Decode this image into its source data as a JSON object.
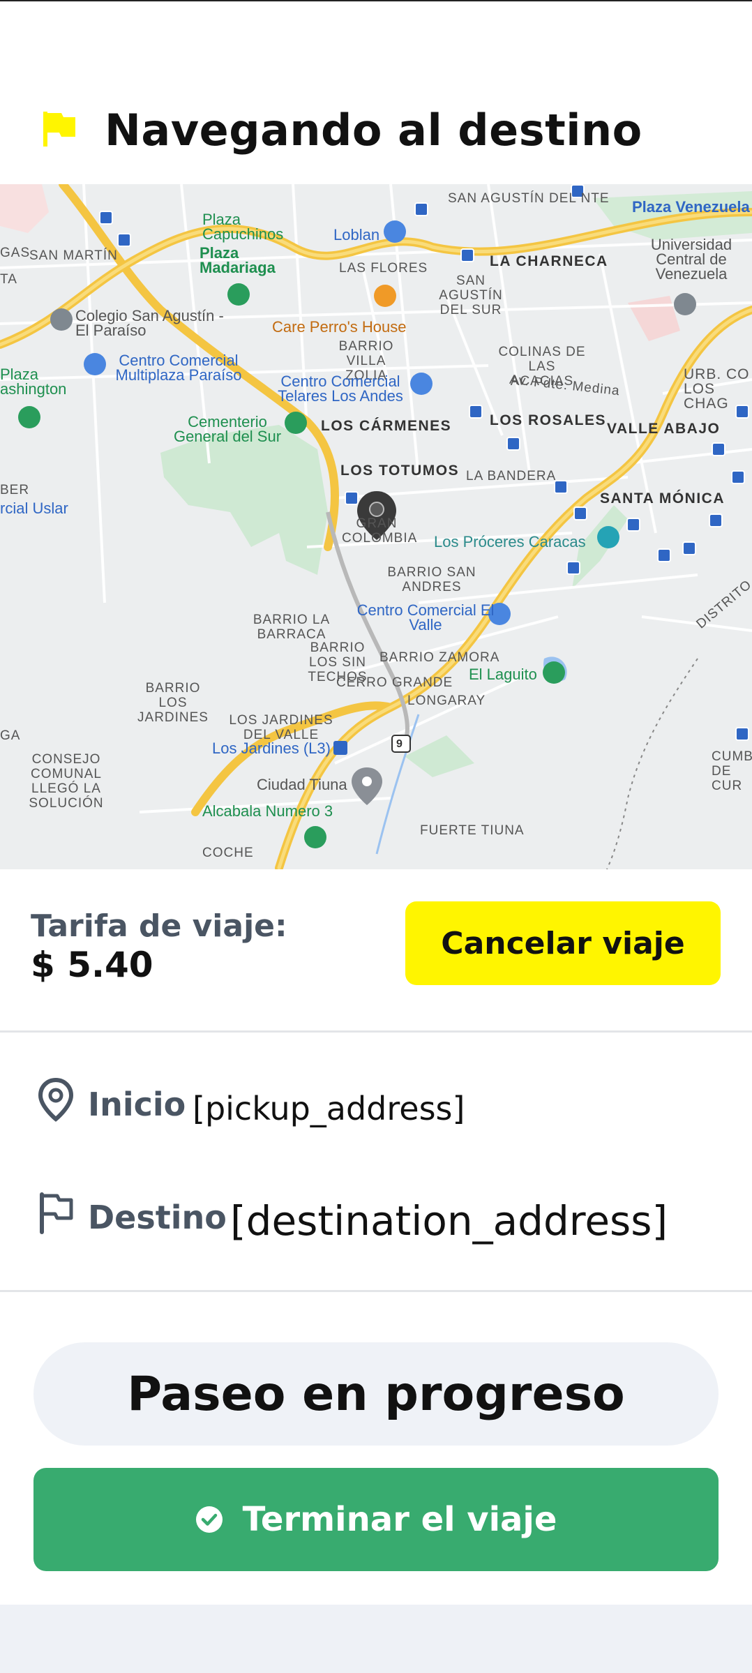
{
  "header": {
    "title": "Navegando al destino",
    "icon": "flag-icon",
    "icon_color": "#fff500"
  },
  "map": {
    "labels": [
      {
        "text": "SAN AGUSTÍN DEL NTE"
      },
      {
        "text": "Plaza Venezuela"
      },
      {
        "text": "Plaza Capuchinos"
      },
      {
        "text": "Loblan"
      },
      {
        "text": "GAS"
      },
      {
        "text": "SAN MARTÍN"
      },
      {
        "text": "Plaza Madariaga"
      },
      {
        "text": "LAS FLORES"
      },
      {
        "text": "LA CHARNECA"
      },
      {
        "text": "Universidad Central de Venezuela"
      },
      {
        "text": "TA"
      },
      {
        "text": "SAN AGUSTÍN DEL SUR"
      },
      {
        "text": "Colegio San Agustín - El Paraíso"
      },
      {
        "text": "Care Perro's House"
      },
      {
        "text": "BARRIO VILLA ZOLIA"
      },
      {
        "text": "COLINAS DE LAS ACACIAS"
      },
      {
        "text": "URB. CO LOS CHAG"
      },
      {
        "text": "Plaza ashington"
      },
      {
        "text": "Centro Comercial Multiplaza Paraíso"
      },
      {
        "text": "Centro Comercial Telares Los Andes"
      },
      {
        "text": "Av. Pdte. Medina"
      },
      {
        "text": "Cementerio General del Sur"
      },
      {
        "text": "LOS CÁRMENES"
      },
      {
        "text": "LOS ROSALES"
      },
      {
        "text": "VALLE ABAJO"
      },
      {
        "text": "LOS TOTUMOS"
      },
      {
        "text": "LA BANDERA"
      },
      {
        "text": "BER"
      },
      {
        "text": "rcial Uslar"
      },
      {
        "text": "SANTA MÓNICA"
      },
      {
        "text": "GRAN COLOMBIA"
      },
      {
        "text": "Los Próceres Caracas"
      },
      {
        "text": "BARRIO SAN ANDRES"
      },
      {
        "text": "DISTRITO"
      },
      {
        "text": "Centro Comercial El Valle"
      },
      {
        "text": "BARRIO LA BARRACA"
      },
      {
        "text": "BARRIO LOS SIN TECHOS"
      },
      {
        "text": "BARRIO ZAMORA"
      },
      {
        "text": "BARRIO LOS JARDINES"
      },
      {
        "text": "CERRO GRANDE"
      },
      {
        "text": "El Laguito"
      },
      {
        "text": "LONGARAY"
      },
      {
        "text": "GA"
      },
      {
        "text": "LOS JARDINES DEL VALLE"
      },
      {
        "text": "Los Jardines (L3)"
      },
      {
        "text": "CONSEJO COMUNAL LLEGÓ LA SOLUCIÓN"
      },
      {
        "text": "CUMB DE CUR"
      },
      {
        "text": "Ciudad Tiuna"
      },
      {
        "text": "Alcabala Numero 3"
      },
      {
        "text": "FUERTE TIUNA"
      },
      {
        "text": "COCHE"
      },
      {
        "text": "9"
      }
    ]
  },
  "fare": {
    "label": "Tarifa de viaje:",
    "value": "$ 5.40"
  },
  "cancel_button": {
    "label": "Cancelar viaje",
    "color": "#fff500"
  },
  "pickup": {
    "label": "Inicio",
    "value": "[pickup_address]",
    "icon": "map-pin-icon"
  },
  "destination": {
    "label": "Destino",
    "value": "[destination_address]",
    "icon": "flag-outline-icon"
  },
  "status": {
    "text": "Paseo en progreso"
  },
  "finish_button": {
    "label": "Terminar el viaje",
    "icon": "check-circle-icon",
    "color": "#38ab6f"
  }
}
